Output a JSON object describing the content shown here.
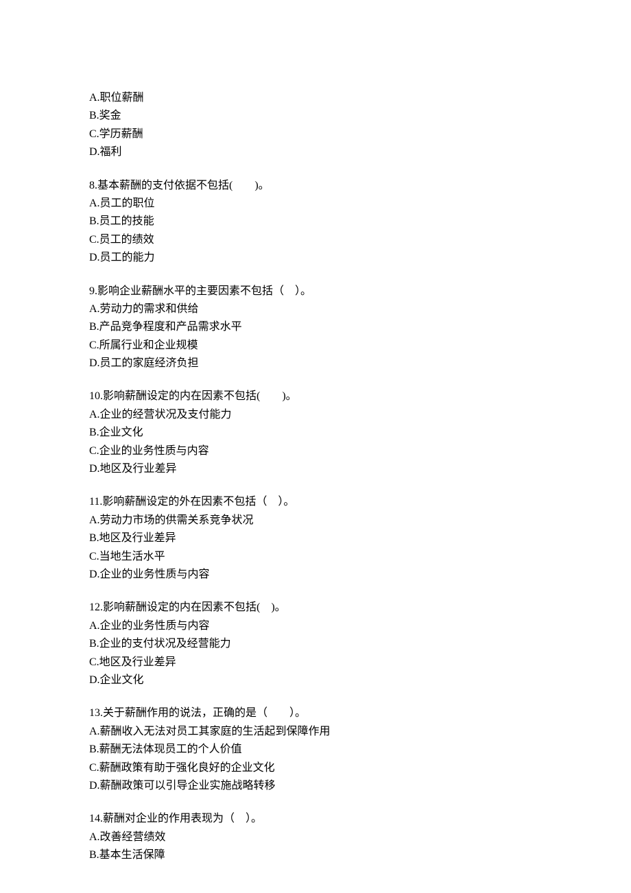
{
  "remainder": {
    "options": [
      "A.职位薪酬",
      "B.奖金",
      "C.学历薪酬",
      "D.福利"
    ]
  },
  "questions": [
    {
      "text": "8.基本薪酬的支付依据不包括(　　)。",
      "options": [
        "A.员工的职位",
        "B.员工的技能",
        "C.员工的绩效",
        "D.员工的能力"
      ]
    },
    {
      "text": "9.影响企业薪酬水平的主要因素不包括（　）。",
      "options": [
        "A.劳动力的需求和供给",
        "B.产品竞争程度和产品需求水平",
        "C.所属行业和企业规模",
        "D.员工的家庭经济负担"
      ]
    },
    {
      "text": "10.影响薪酬设定的内在因素不包括(　　)。",
      "options": [
        "A.企业的经营状况及支付能力",
        "B.企业文化",
        "C.企业的业务性质与内容",
        "D.地区及行业差异"
      ]
    },
    {
      "text": "11.影响薪酬设定的外在因素不包括（　）。",
      "options": [
        "A.劳动力市场的供需关系竞争状况",
        "B.地区及行业差异",
        "C.当地生活水平",
        "D.企业的业务性质与内容"
      ]
    },
    {
      "text": "12.影响薪酬设定的内在因素不包括(　)。",
      "options": [
        "A.企业的业务性质与内容",
        "B.企业的支付状况及经营能力",
        "C.地区及行业差异",
        "D.企业文化"
      ]
    },
    {
      "text": "13.关于薪酬作用的说法，正确的是（　　）。",
      "options": [
        "A.薪酬收入无法对员工其家庭的生活起到保障作用",
        "B.薪酬无法体现员工的个人价值",
        "C.薪酬政策有助于强化良好的企业文化",
        "D.薪酬政策可以引导企业实施战略转移"
      ]
    },
    {
      "text": "14.薪酬对企业的作用表现为（　）。",
      "options": [
        "A.改善经营绩效",
        "B.基本生活保障"
      ]
    }
  ]
}
